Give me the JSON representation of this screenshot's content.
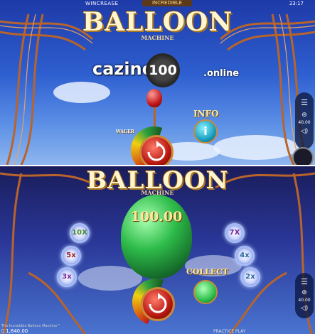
{
  "status_bar": {
    "brand": "WINCREASE",
    "game_badge": "INCREDIBLE",
    "time": "23:17"
  },
  "top_panel": {
    "title": "BALLOON",
    "subtitle": "MACHINE",
    "watermark": {
      "left": "cazino",
      "coin": "100",
      "right": ".online"
    },
    "info_label": "INFO",
    "info_icon": "i",
    "side_bet": "40.00",
    "wager_label": "WAGER"
  },
  "bottom_panel": {
    "title": "BALLOON",
    "subtitle": "MACHINE",
    "balloon_value": "100.00",
    "multipliers_left": [
      "10X",
      "5x",
      "3x"
    ],
    "multipliers_right": [
      "7X",
      "4x",
      "2x"
    ],
    "collect_label": "COLLECT",
    "side_bet": "40.00",
    "footer_game": "The Incredible Balloon Machine™",
    "balance": "1,840.00",
    "mode": "PRACTICE PLAY"
  },
  "colors": {
    "sky_top": "#1e3aa8",
    "sky_bottom": "#8fb6ee",
    "balloon_green": "#1f9a3a",
    "collect_green": "#2ec04a",
    "info_teal": "#1aa0c0",
    "copper": "#b8642a"
  }
}
